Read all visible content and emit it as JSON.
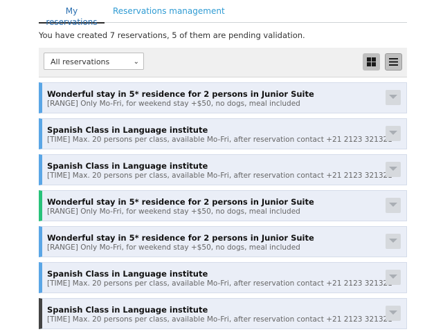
{
  "tabs": [
    {
      "label": "My reservations",
      "active": true
    },
    {
      "label": "Reservations management",
      "active": false
    }
  ],
  "summary": "You have created 7 reservations, 5 of them are pending validation.",
  "filter": {
    "selected": "All reservations"
  },
  "view_toggle": {
    "grid_icon": "grid-icon",
    "list_icon": "list-icon",
    "active": "list"
  },
  "reservations": [
    {
      "title": "Wonderful stay in 5* residence for 2 persons in Junior Suite",
      "details": "[RANGE] Only Mo-Fri, for weekend stay +$50, no dogs, meal included",
      "status_color": "#5aa6e6"
    },
    {
      "title": "Spanish Class in Language institute",
      "details": "[TIME] Max. 20 persons per class, available Mo-Fri, after reservation contact +21 2123 321321",
      "status_color": "#5aa6e6"
    },
    {
      "title": "Spanish Class in Language institute",
      "details": "[TIME] Max. 20 persons per class, available Mo-Fri, after reservation contact +21 2123 321321",
      "status_color": "#5aa6e6"
    },
    {
      "title": "Wonderful stay in 5* residence for 2 persons in Junior Suite",
      "details": "[RANGE] Only Mo-Fri, for weekend stay +$50, no dogs, meal included",
      "status_color": "#28c27a"
    },
    {
      "title": "Wonderful stay in 5* residence for 2 persons in Junior Suite",
      "details": "[RANGE] Only Mo-Fri, for weekend stay +$50, no dogs, meal included",
      "status_color": "#5aa6e6"
    },
    {
      "title": "Spanish Class in Language institute",
      "details": "[TIME] Max. 20 persons per class, available Mo-Fri, after reservation contact +21 2123 321321",
      "status_color": "#5aa6e6"
    },
    {
      "title": "Spanish Class in Language institute",
      "details": "[TIME] Max. 20 persons per class, available Mo-Fri, after reservation contact +21 2123 321321",
      "status_color": "#444444"
    }
  ]
}
